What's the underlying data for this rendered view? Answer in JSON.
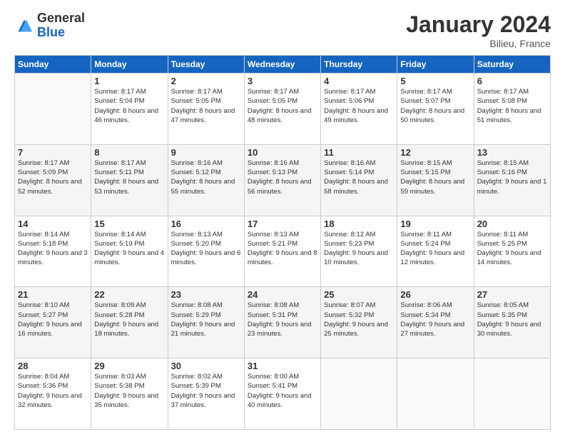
{
  "logo": {
    "general": "General",
    "blue": "Blue"
  },
  "title": "January 2024",
  "location": "Bilieu, France",
  "days_header": [
    "Sunday",
    "Monday",
    "Tuesday",
    "Wednesday",
    "Thursday",
    "Friday",
    "Saturday"
  ],
  "weeks": [
    [
      {
        "num": "",
        "sunrise": "",
        "sunset": "",
        "daylight": ""
      },
      {
        "num": "1",
        "sunrise": "Sunrise: 8:17 AM",
        "sunset": "Sunset: 5:04 PM",
        "daylight": "Daylight: 8 hours and 46 minutes."
      },
      {
        "num": "2",
        "sunrise": "Sunrise: 8:17 AM",
        "sunset": "Sunset: 5:05 PM",
        "daylight": "Daylight: 8 hours and 47 minutes."
      },
      {
        "num": "3",
        "sunrise": "Sunrise: 8:17 AM",
        "sunset": "Sunset: 5:05 PM",
        "daylight": "Daylight: 8 hours and 48 minutes."
      },
      {
        "num": "4",
        "sunrise": "Sunrise: 8:17 AM",
        "sunset": "Sunset: 5:06 PM",
        "daylight": "Daylight: 8 hours and 49 minutes."
      },
      {
        "num": "5",
        "sunrise": "Sunrise: 8:17 AM",
        "sunset": "Sunset: 5:07 PM",
        "daylight": "Daylight: 8 hours and 50 minutes."
      },
      {
        "num": "6",
        "sunrise": "Sunrise: 8:17 AM",
        "sunset": "Sunset: 5:08 PM",
        "daylight": "Daylight: 8 hours and 51 minutes."
      }
    ],
    [
      {
        "num": "7",
        "sunrise": "Sunrise: 8:17 AM",
        "sunset": "Sunset: 5:09 PM",
        "daylight": "Daylight: 8 hours and 52 minutes."
      },
      {
        "num": "8",
        "sunrise": "Sunrise: 8:17 AM",
        "sunset": "Sunset: 5:11 PM",
        "daylight": "Daylight: 8 hours and 53 minutes."
      },
      {
        "num": "9",
        "sunrise": "Sunrise: 8:16 AM",
        "sunset": "Sunset: 5:12 PM",
        "daylight": "Daylight: 8 hours and 55 minutes."
      },
      {
        "num": "10",
        "sunrise": "Sunrise: 8:16 AM",
        "sunset": "Sunset: 5:13 PM",
        "daylight": "Daylight: 8 hours and 56 minutes."
      },
      {
        "num": "11",
        "sunrise": "Sunrise: 8:16 AM",
        "sunset": "Sunset: 5:14 PM",
        "daylight": "Daylight: 8 hours and 58 minutes."
      },
      {
        "num": "12",
        "sunrise": "Sunrise: 8:15 AM",
        "sunset": "Sunset: 5:15 PM",
        "daylight": "Daylight: 8 hours and 59 minutes."
      },
      {
        "num": "13",
        "sunrise": "Sunrise: 8:15 AM",
        "sunset": "Sunset: 5:16 PM",
        "daylight": "Daylight: 9 hours and 1 minute."
      }
    ],
    [
      {
        "num": "14",
        "sunrise": "Sunrise: 8:14 AM",
        "sunset": "Sunset: 5:18 PM",
        "daylight": "Daylight: 9 hours and 3 minutes."
      },
      {
        "num": "15",
        "sunrise": "Sunrise: 8:14 AM",
        "sunset": "Sunset: 5:19 PM",
        "daylight": "Daylight: 9 hours and 4 minutes."
      },
      {
        "num": "16",
        "sunrise": "Sunrise: 8:13 AM",
        "sunset": "Sunset: 5:20 PM",
        "daylight": "Daylight: 9 hours and 6 minutes."
      },
      {
        "num": "17",
        "sunrise": "Sunrise: 8:13 AM",
        "sunset": "Sunset: 5:21 PM",
        "daylight": "Daylight: 9 hours and 8 minutes."
      },
      {
        "num": "18",
        "sunrise": "Sunrise: 8:12 AM",
        "sunset": "Sunset: 5:23 PM",
        "daylight": "Daylight: 9 hours and 10 minutes."
      },
      {
        "num": "19",
        "sunrise": "Sunrise: 8:11 AM",
        "sunset": "Sunset: 5:24 PM",
        "daylight": "Daylight: 9 hours and 12 minutes."
      },
      {
        "num": "20",
        "sunrise": "Sunrise: 8:11 AM",
        "sunset": "Sunset: 5:25 PM",
        "daylight": "Daylight: 9 hours and 14 minutes."
      }
    ],
    [
      {
        "num": "21",
        "sunrise": "Sunrise: 8:10 AM",
        "sunset": "Sunset: 5:27 PM",
        "daylight": "Daylight: 9 hours and 16 minutes."
      },
      {
        "num": "22",
        "sunrise": "Sunrise: 8:09 AM",
        "sunset": "Sunset: 5:28 PM",
        "daylight": "Daylight: 9 hours and 18 minutes."
      },
      {
        "num": "23",
        "sunrise": "Sunrise: 8:08 AM",
        "sunset": "Sunset: 5:29 PM",
        "daylight": "Daylight: 9 hours and 21 minutes."
      },
      {
        "num": "24",
        "sunrise": "Sunrise: 8:08 AM",
        "sunset": "Sunset: 5:31 PM",
        "daylight": "Daylight: 9 hours and 23 minutes."
      },
      {
        "num": "25",
        "sunrise": "Sunrise: 8:07 AM",
        "sunset": "Sunset: 5:32 PM",
        "daylight": "Daylight: 9 hours and 25 minutes."
      },
      {
        "num": "26",
        "sunrise": "Sunrise: 8:06 AM",
        "sunset": "Sunset: 5:34 PM",
        "daylight": "Daylight: 9 hours and 27 minutes."
      },
      {
        "num": "27",
        "sunrise": "Sunrise: 8:05 AM",
        "sunset": "Sunset: 5:35 PM",
        "daylight": "Daylight: 9 hours and 30 minutes."
      }
    ],
    [
      {
        "num": "28",
        "sunrise": "Sunrise: 8:04 AM",
        "sunset": "Sunset: 5:36 PM",
        "daylight": "Daylight: 9 hours and 32 minutes."
      },
      {
        "num": "29",
        "sunrise": "Sunrise: 8:03 AM",
        "sunset": "Sunset: 5:38 PM",
        "daylight": "Daylight: 9 hours and 35 minutes."
      },
      {
        "num": "30",
        "sunrise": "Sunrise: 8:02 AM",
        "sunset": "Sunset: 5:39 PM",
        "daylight": "Daylight: 9 hours and 37 minutes."
      },
      {
        "num": "31",
        "sunrise": "Sunrise: 8:00 AM",
        "sunset": "Sunset: 5:41 PM",
        "daylight": "Daylight: 9 hours and 40 minutes."
      },
      {
        "num": "",
        "sunrise": "",
        "sunset": "",
        "daylight": ""
      },
      {
        "num": "",
        "sunrise": "",
        "sunset": "",
        "daylight": ""
      },
      {
        "num": "",
        "sunrise": "",
        "sunset": "",
        "daylight": ""
      }
    ]
  ]
}
